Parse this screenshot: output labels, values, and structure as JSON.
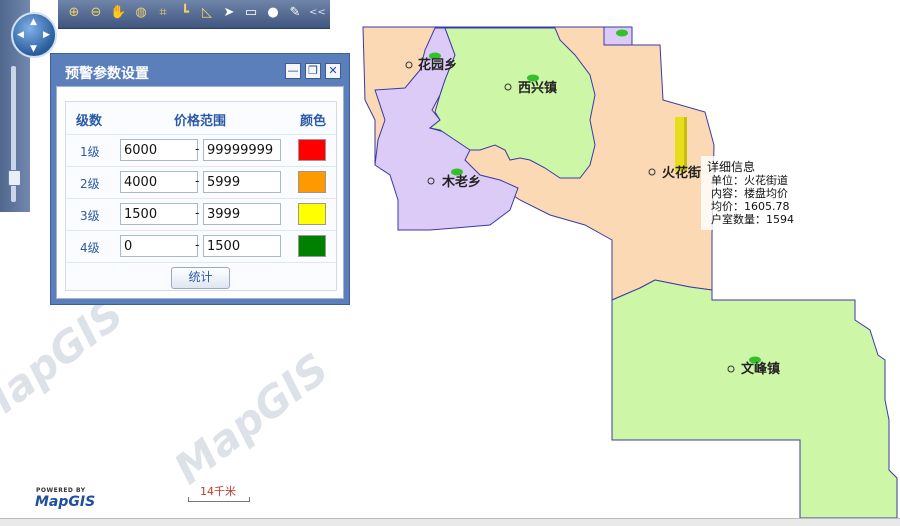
{
  "toolbar": {
    "tools": [
      "zoom-in-icon",
      "zoom-out-icon",
      "pan-hand-icon",
      "full-extent-icon",
      "fit-window-icon",
      "measure-distance-icon",
      "measure-angle-icon",
      "select-pointer-icon",
      "rectangle-select-icon",
      "circle-select-icon",
      "clear-icon",
      "collapse-icon"
    ],
    "collapse_label": "<<"
  },
  "dialog": {
    "title": "预警参数设置",
    "headers": {
      "level": "级数",
      "range": "价格范围",
      "color": "颜色"
    },
    "rows": [
      {
        "level": "1级",
        "min": "6000",
        "max": "99999999",
        "color": "#ff0000"
      },
      {
        "level": "2级",
        "min": "4000",
        "max": "5999",
        "color": "#ff9900"
      },
      {
        "level": "3级",
        "min": "1500",
        "max": "3999",
        "color": "#ffff00"
      },
      {
        "level": "4级",
        "min": "0",
        "max": "1500",
        "color": "#008000"
      }
    ],
    "dash": "-",
    "stat_button": "统计"
  },
  "map": {
    "labels": {
      "huayuan": "花园乡",
      "xixing": "西兴镇",
      "mulao": "木老乡",
      "huohua": "火花街",
      "wenfeng": "文峰镇"
    },
    "colors": {
      "purple": "#dccbf7",
      "green": "#cdf7a6",
      "orange": "#fbd9b4",
      "border": "#3a3aa8",
      "bar": "#e8df1a"
    }
  },
  "tooltip": {
    "title": "详细信息",
    "unit": "单位：火花街道",
    "content": "内容：楼盘均价",
    "price": "均价：1605.78",
    "households": "户室数量：1594"
  },
  "branding": {
    "powered_by": "POWERED BY",
    "logo": "MapGIS",
    "watermark": "MapGIS"
  },
  "scale": {
    "label": "14千米"
  }
}
